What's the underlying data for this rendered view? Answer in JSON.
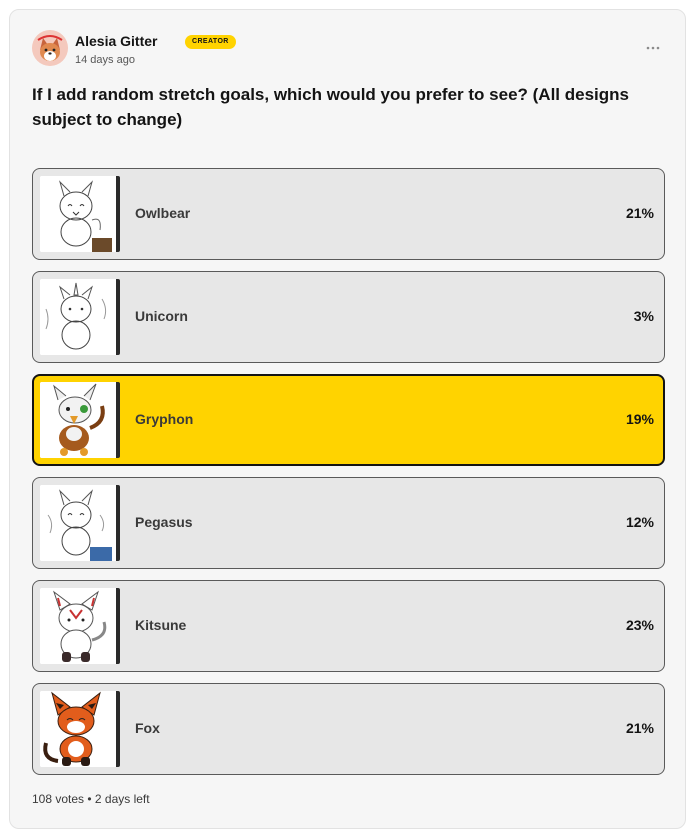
{
  "post": {
    "author_name": "Alesia Gitter",
    "author_badge": "CREATOR",
    "timestamp": "14 days ago",
    "more_icon": "more-horizontal-icon",
    "question": "If I add random stretch goals, which would you prefer to see? (All designs subject to change)"
  },
  "poll": {
    "options": [
      {
        "label": "Owlbear",
        "percent": "21%",
        "selected": false
      },
      {
        "label": "Unicorn",
        "percent": "3%",
        "selected": false
      },
      {
        "label": "Gryphon",
        "percent": "19%",
        "selected": true
      },
      {
        "label": "Pegasus",
        "percent": "12%",
        "selected": false
      },
      {
        "label": "Kitsune",
        "percent": "23%",
        "selected": false
      },
      {
        "label": "Fox",
        "percent": "21%",
        "selected": false
      }
    ],
    "footer": "108 votes • 2 days left"
  },
  "colors": {
    "accent": "#ffd300",
    "card_background": "#f6f6f6",
    "option_background": "#e7e7e7",
    "text": "#141414"
  }
}
